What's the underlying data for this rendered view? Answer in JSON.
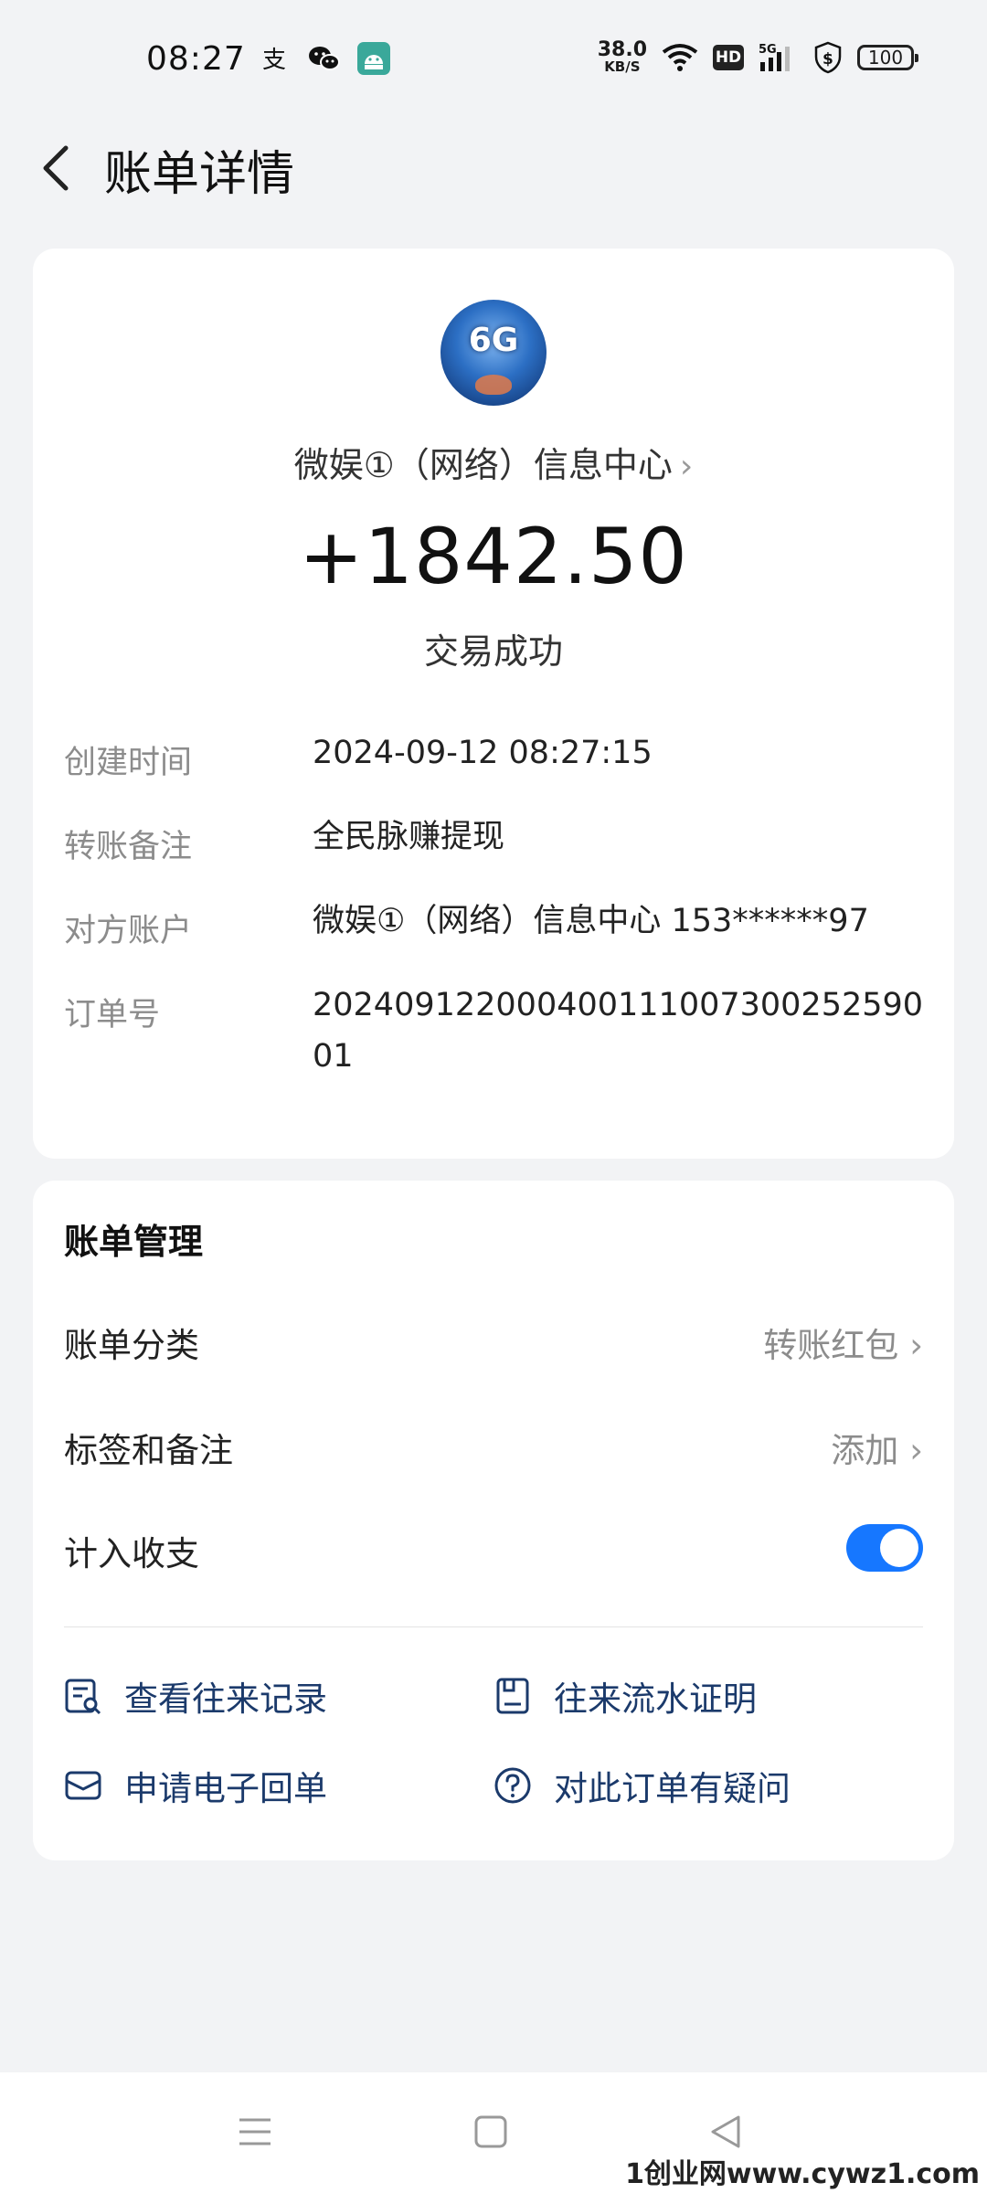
{
  "status_bar": {
    "time": "08:27",
    "net_speed_value": "38.0",
    "net_speed_unit": "KB/S",
    "hd": "HD",
    "signal": "5G",
    "battery": "100"
  },
  "header": {
    "title": "账单详情"
  },
  "transaction": {
    "merchant": "微娱①（网络）信息中心",
    "amount": "+1842.50",
    "status": "交易成功",
    "avatar_text": "6G"
  },
  "details": [
    {
      "label": "创建时间",
      "value": "2024-09-12 08:27:15"
    },
    {
      "label": "转账备注",
      "value": "全民脉赚提现"
    },
    {
      "label": "对方账户",
      "value": "微娱①（网络）信息中心 153******97"
    },
    {
      "label": "订单号",
      "value": "20240912200040011100730025259001"
    }
  ],
  "management": {
    "title": "账单管理",
    "category_label": "账单分类",
    "category_value": "转账红包",
    "tags_label": "标签和备注",
    "tags_value": "添加",
    "include_label": "计入收支",
    "include_on": true
  },
  "actions": {
    "records": "查看往来记录",
    "proof": "往来流水证明",
    "receipt": "申请电子回单",
    "question": "对此订单有疑问"
  },
  "watermark": "1创业网www.cywz1.com",
  "colors": {
    "accent": "#1677ff",
    "action_text": "#1b3a6b",
    "background": "#f2f3f5"
  }
}
